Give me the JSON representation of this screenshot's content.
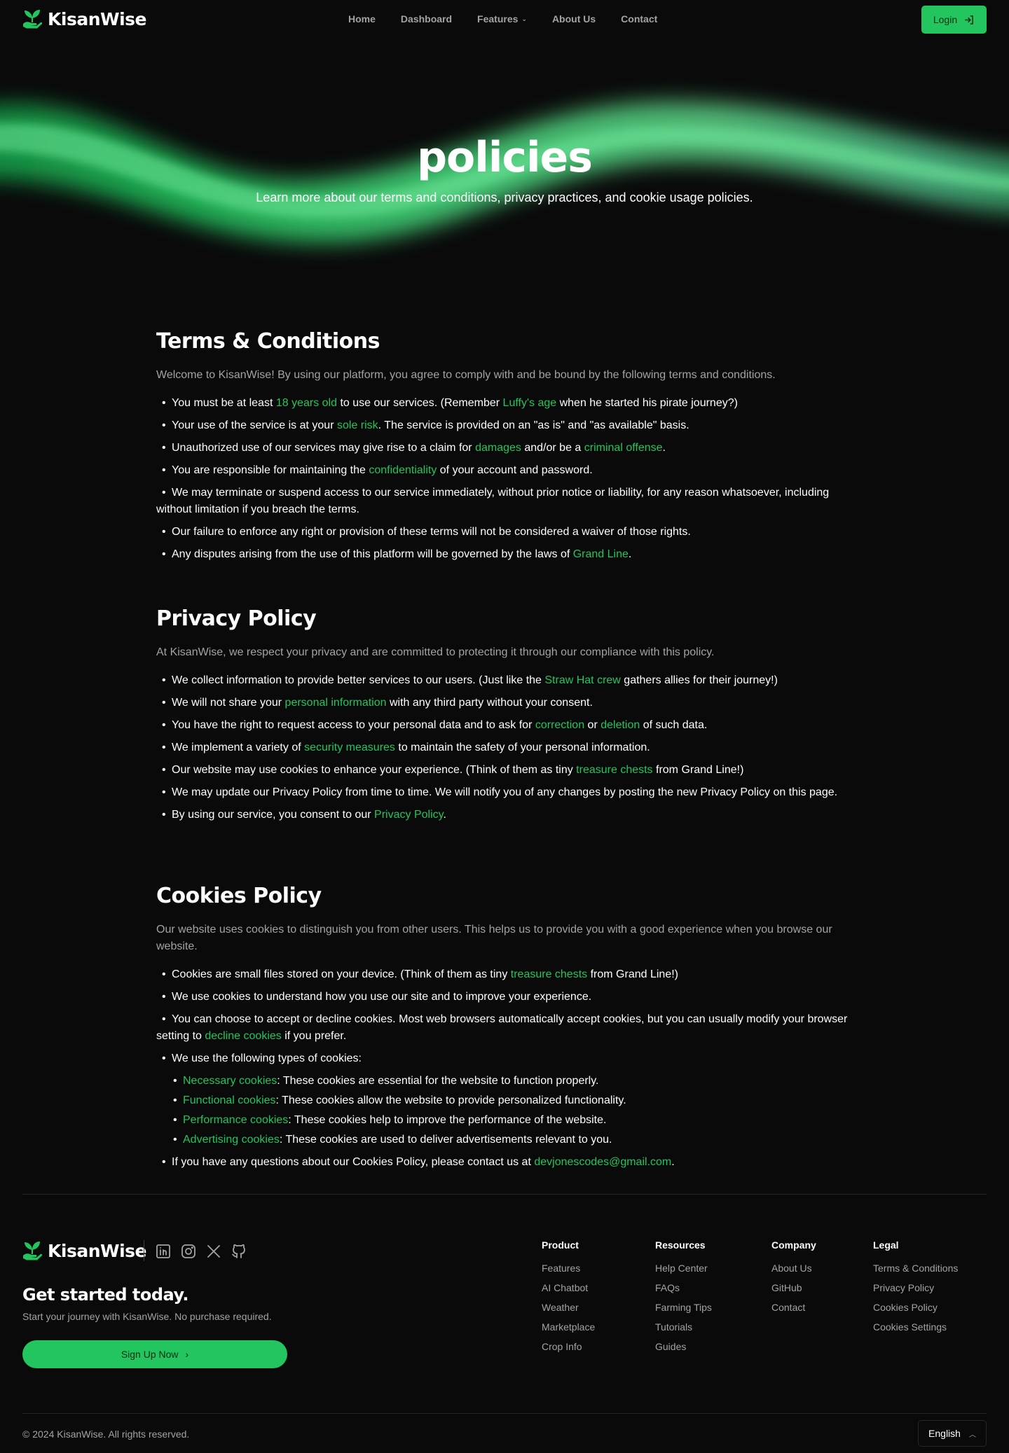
{
  "nav": {
    "brand": "KisanWise",
    "items": [
      {
        "label": "Home"
      },
      {
        "label": "Dashboard"
      },
      {
        "label": "Features"
      },
      {
        "label": "About Us"
      },
      {
        "label": "Contact"
      }
    ],
    "login_label": "Login"
  },
  "hero": {
    "title": "policies",
    "subtitle": "Learn more about our terms and conditions, privacy practices, and cookie usage policies."
  },
  "terms": {
    "heading": "Terms & Conditions",
    "intro": "Welcome to KisanWise! By using our platform, you agree to comply with and be bound by the following terms and conditions.",
    "i1": {
      "a": "You must be at least ",
      "b": "18 years old",
      "c": " to use our services. (Remember ",
      "d": "Luffy's age",
      "e": " when he started his pirate journey?)"
    },
    "i2": {
      "a": "Your use of the service is at your ",
      "b": "sole risk",
      "c": ". The service is provided on an \"as is\" and \"as available\" basis."
    },
    "i3": {
      "a": "Unauthorized use of our services may give rise to a claim for ",
      "b": "damages",
      "c": " and/or be a ",
      "d": "criminal offense",
      "e": "."
    },
    "i4": {
      "a": "You are responsible for maintaining the ",
      "b": "confidentiality",
      "c": " of your account and password."
    },
    "i5": {
      "a": "We may terminate or suspend access to our service immediately, without prior notice or liability, for any reason whatsoever, including without limitation if you breach the terms."
    },
    "i6": {
      "a": "Our failure to enforce any right or provision of these terms will not be considered a waiver of those rights."
    },
    "i7": {
      "a": "Any disputes arising from the use of this platform will be governed by the laws of ",
      "b": "Grand Line",
      "c": "."
    }
  },
  "privacy": {
    "heading": "Privacy Policy",
    "intro": "At KisanWise, we respect your privacy and are committed to protecting it through our compliance with this policy.",
    "i1": {
      "a": "We collect information to provide better services to our users. (Just like the ",
      "b": "Straw Hat crew",
      "c": " gathers allies for their journey!)"
    },
    "i2": {
      "a": "We will not share your ",
      "b": "personal information",
      "c": " with any third party without your consent."
    },
    "i3": {
      "a": "You have the right to request access to your personal data and to ask for ",
      "b": "correction",
      "c": " or ",
      "d": "deletion",
      "e": " of such data."
    },
    "i4": {
      "a": "We implement a variety of ",
      "b": "security measures",
      "c": " to maintain the safety of your personal information."
    },
    "i5": {
      "a": "Our website may use cookies to enhance your experience. (Think of them as tiny ",
      "b": "treasure chests",
      "c": " from Grand Line!)"
    },
    "i6": {
      "a": "We may update our Privacy Policy from time to time. We will notify you of any changes by posting the new Privacy Policy on this page."
    },
    "i7": {
      "a": "By using our service, you consent to our ",
      "b": "Privacy Policy",
      "c": "."
    }
  },
  "cookies": {
    "heading": "Cookies Policy",
    "intro": "Our website uses cookies to distinguish you from other users. This helps us to provide you with a good experience when you browse our website.",
    "i1": {
      "a": "Cookies are small files stored on your device. (Think of them as tiny ",
      "b": "treasure chests",
      "c": " from Grand Line!)"
    },
    "i2": {
      "a": "We use cookies to understand how you use our site and to improve your experience."
    },
    "i3": {
      "a": "You can choose to accept or decline cookies. Most web browsers automatically accept cookies, but you can usually modify your browser setting to ",
      "b": "decline cookies",
      "c": " if you prefer."
    },
    "i4": {
      "a": "We use the following types of cookies:"
    },
    "types": [
      {
        "name": "Necessary cookies",
        "desc": ": These cookies are essential for the website to function properly."
      },
      {
        "name": "Functional cookies",
        "desc": ": These cookies allow the website to provide personalized functionality."
      },
      {
        "name": "Performance cookies",
        "desc": ": These cookies help to improve the performance of the website."
      },
      {
        "name": "Advertising cookies",
        "desc": ": These cookies are used to deliver advertisements relevant to you."
      }
    ],
    "i5": {
      "a": "If you have any questions about our Cookies Policy, please contact us at ",
      "b": "devjonescodes@gmail.com",
      "c": "."
    }
  },
  "footer": {
    "brand": "KisanWise",
    "socials": [
      "linkedin-icon",
      "instagram-icon",
      "x-icon",
      "github-icon"
    ],
    "cta_title": "Get started today.",
    "cta_sub": "Start your journey with KisanWise. No purchase required.",
    "signup_label": "Sign Up Now",
    "columns": [
      {
        "title": "Product",
        "links": [
          "Features",
          "AI Chatbot",
          "Weather",
          "Marketplace",
          "Crop Info"
        ]
      },
      {
        "title": "Resources",
        "links": [
          "Help Center",
          "FAQs",
          "Farming Tips",
          "Tutorials",
          "Guides"
        ]
      },
      {
        "title": "Company",
        "links": [
          "About Us",
          "GitHub",
          "Contact"
        ]
      },
      {
        "title": "Legal",
        "links": [
          "Terms & Conditions",
          "Privacy Policy",
          "Cookies Policy",
          "Cookies Settings"
        ]
      }
    ],
    "copyright": "© 2024 KisanWise. All rights reserved.",
    "language": "English"
  },
  "colors": {
    "accent": "#22c55e",
    "background": "#0a0a0a",
    "muted": "#a3a3a3"
  }
}
